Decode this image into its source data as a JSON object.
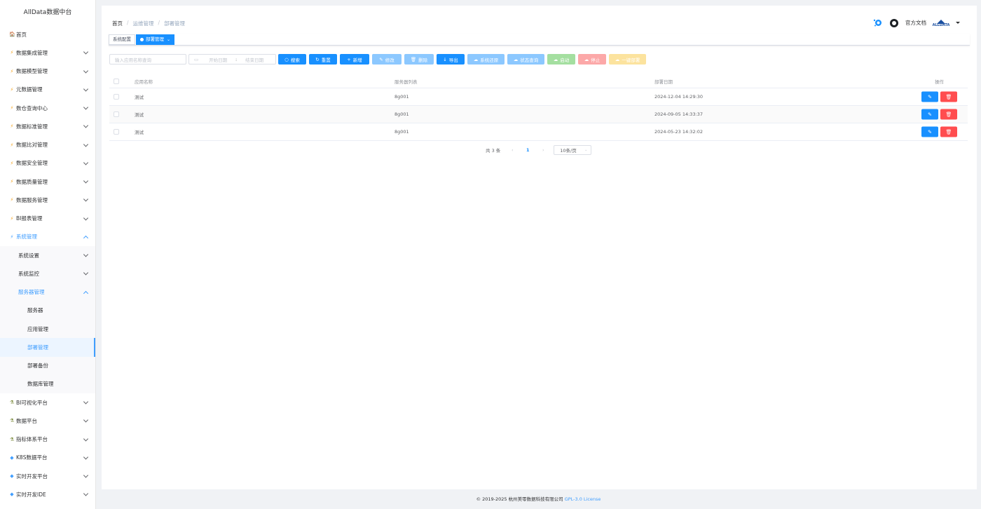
{
  "app": {
    "title": "AllData数据中台"
  },
  "sidebar": {
    "items": [
      {
        "icon": "home-icon",
        "label": "首页"
      },
      {
        "icon": "bolt-icon",
        "label": "数据集成管理"
      },
      {
        "icon": "bolt-icon",
        "label": "数据模型管理"
      },
      {
        "icon": "bolt-icon",
        "label": "元数据管理"
      },
      {
        "icon": "bolt-icon",
        "label": "数仓查询中心"
      },
      {
        "icon": "bolt-icon",
        "label": "数据标准管理"
      },
      {
        "icon": "bolt-icon",
        "label": "数据比对管理"
      },
      {
        "icon": "bolt-icon",
        "label": "数据安全管理"
      },
      {
        "icon": "bolt-icon",
        "label": "数据质量管理"
      },
      {
        "icon": "bolt-icon",
        "label": "数据服务管理"
      },
      {
        "icon": "bolt-icon",
        "label": "BI报表管理"
      },
      {
        "icon": "bolt-icon",
        "label": "系统管理"
      },
      {
        "label": "系统设置"
      },
      {
        "label": "系统监控"
      },
      {
        "label": "服务器管理"
      },
      {
        "label": "服务器"
      },
      {
        "label": "应用管理"
      },
      {
        "label": "部署管理"
      },
      {
        "label": "部署备份"
      },
      {
        "label": "数据库管理"
      },
      {
        "icon": "people-icon",
        "label": "BI可视化平台"
      },
      {
        "icon": "people-icon",
        "label": "数据平台"
      },
      {
        "icon": "people-icon",
        "label": "指标体系平台"
      },
      {
        "icon": "diamond-icon",
        "label": "K8S数据平台"
      },
      {
        "icon": "diamond-icon",
        "label": "实时开发平台"
      },
      {
        "icon": "diamond-icon",
        "label": "实时开发IDE"
      }
    ]
  },
  "header": {
    "breadcrumb": [
      "首页",
      "运维管理",
      "部署管理"
    ],
    "docs_label": "官方文档",
    "avatar_text": "ALLDATA"
  },
  "tags": [
    {
      "label": "系统配置"
    },
    {
      "label": "部署管理"
    }
  ],
  "toolbar": {
    "search_placeholder": "输入应用名称查询",
    "start_placeholder": "开始日期",
    "date_sep": ":",
    "end_placeholder": "结束日期",
    "search_label": "搜索",
    "reset_label": "重置",
    "add_label": "新增",
    "edit_label": "修改",
    "delete_label": "删除",
    "export_label": "导出",
    "sys_restore_label": "系统还原",
    "status_query_label": "状态查询",
    "start_label": "启动",
    "stop_label": "停止",
    "deploy_label": "一键部署"
  },
  "table": {
    "columns": [
      "应用名称",
      "服务器列表",
      "部署日期",
      "操作"
    ],
    "rows": [
      {
        "app": "测试",
        "server": "8g001",
        "date": "2024-12-04 14:29:30"
      },
      {
        "app": "测试",
        "server": "8g001",
        "date": "2024-09-05 14:33:37"
      },
      {
        "app": "测试",
        "server": "8g001",
        "date": "2024-05-23 14:32:02"
      }
    ]
  },
  "pager": {
    "total": "共 3 条",
    "current": "1",
    "size": "10条/页"
  },
  "footer": {
    "copyright": "© 2019-2025 杭州美零数据科技有限公司",
    "license": "GPL-3.0 License"
  },
  "colors": {
    "primary": "#1890ff",
    "danger": "#ff4d4f",
    "menu_active": "#409eff"
  }
}
